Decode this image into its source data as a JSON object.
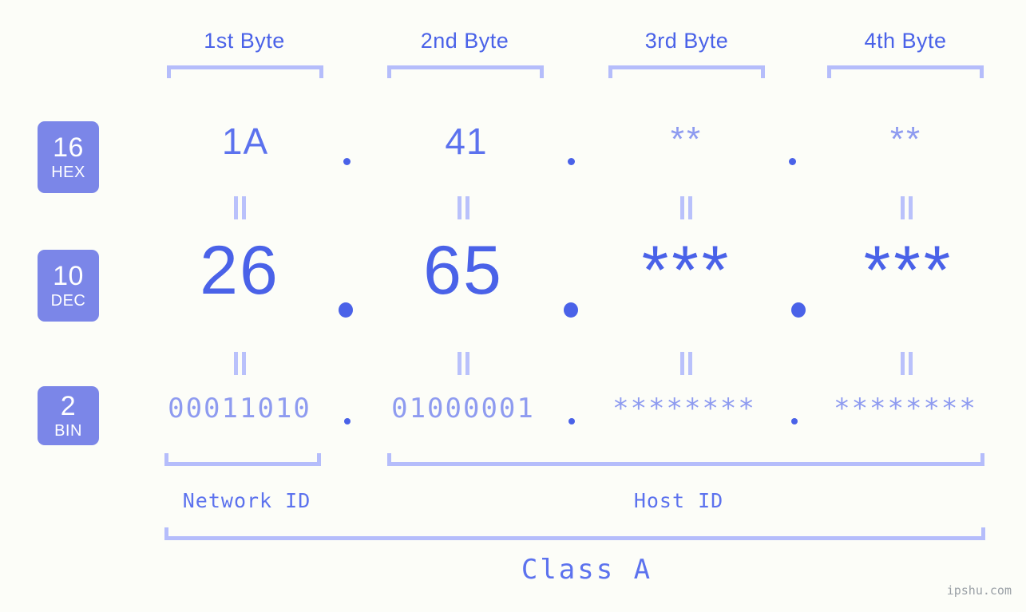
{
  "headers": [
    {
      "label": "1st Byte"
    },
    {
      "label": "2nd Byte"
    },
    {
      "label": "3rd Byte"
    },
    {
      "label": "4th Byte"
    }
  ],
  "badges": [
    {
      "num": "16",
      "sub": "HEX"
    },
    {
      "num": "10",
      "sub": "DEC"
    },
    {
      "num": "2",
      "sub": "BIN"
    }
  ],
  "rows": {
    "hex": {
      "values": [
        "1A",
        "41",
        "**",
        "**"
      ]
    },
    "dec": {
      "values": [
        "26",
        "65",
        "***",
        "***"
      ]
    },
    "bin": {
      "values": [
        "00011010",
        "01000001",
        "********",
        "********"
      ]
    }
  },
  "separators": {
    "dot": "."
  },
  "equals": {
    "mark": "="
  },
  "sections": {
    "network_id": "Network ID",
    "host_id": "Host ID",
    "class": "Class A"
  },
  "watermark": "ipshu.com",
  "colors": {
    "background": "#fcfdf8",
    "accent_strong": "#4a62e8",
    "accent_mid": "#5c72ee",
    "accent_light": "#8e9bf0",
    "bracket": "#b5bdfb",
    "badge_bg": "#7b86e8",
    "watermark": "#9aa0a6"
  }
}
